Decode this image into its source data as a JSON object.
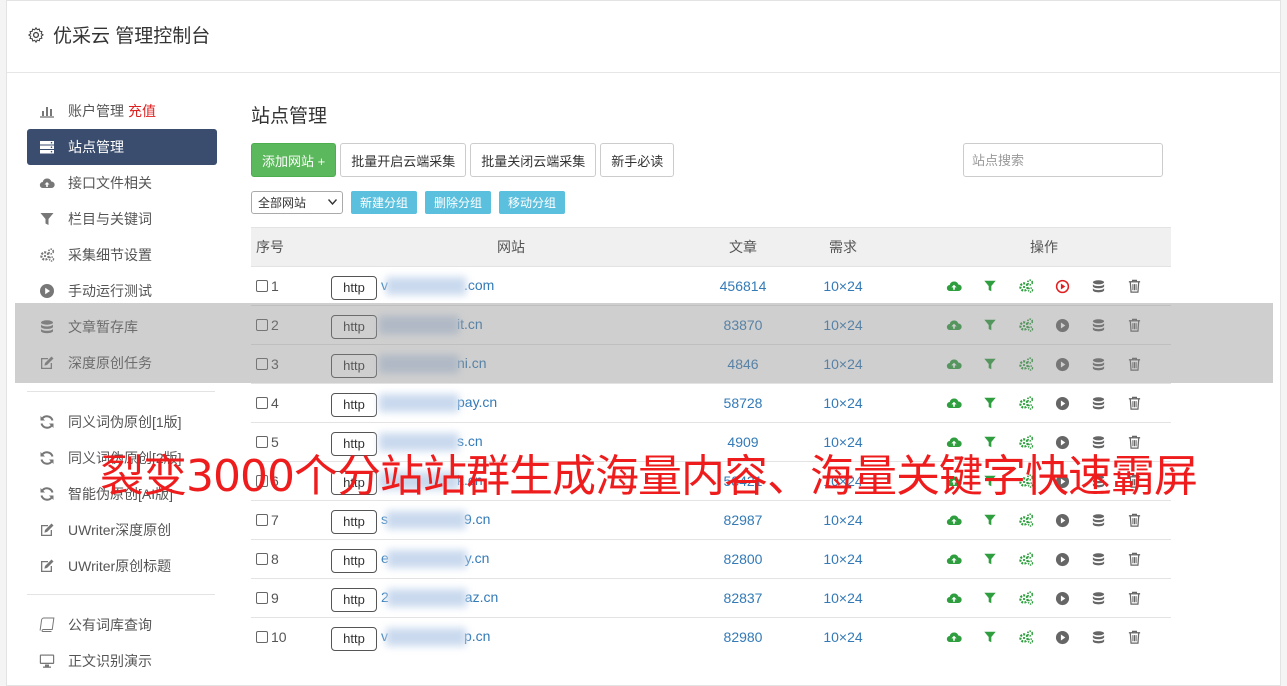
{
  "header": {
    "title": "优采云 管理控制台"
  },
  "sidebar": {
    "group1": [
      {
        "label": "账户管理",
        "extra": "充值",
        "icon": "bar-chart-icon"
      },
      {
        "label": "站点管理",
        "icon": "server-icon",
        "active": true
      },
      {
        "label": "接口文件相关",
        "icon": "cloud-upload-icon"
      },
      {
        "label": "栏目与关键词",
        "icon": "filter-icon"
      },
      {
        "label": "采集细节设置",
        "icon": "gears-icon"
      },
      {
        "label": "手动运行测试",
        "icon": "play-circle-icon"
      },
      {
        "label": "文章暂存库",
        "icon": "database-icon"
      },
      {
        "label": "深度原创任务",
        "icon": "edit-icon"
      }
    ],
    "group2": [
      {
        "label": "同义词伪原创[1版]",
        "icon": "refresh-icon"
      },
      {
        "label": "同义词伪原创[2版]",
        "icon": "refresh-icon"
      },
      {
        "label": "智能伪原创[AI版]",
        "icon": "refresh-icon"
      },
      {
        "label": "UWriter深度原创",
        "icon": "edit-icon"
      },
      {
        "label": "UWriter原创标题",
        "icon": "edit-icon"
      }
    ],
    "group3": [
      {
        "label": "公有词库查询",
        "icon": "book-icon"
      },
      {
        "label": "正文识别演示",
        "icon": "monitor-icon"
      }
    ]
  },
  "main": {
    "title": "站点管理",
    "buttons": {
      "add": "添加网站 +",
      "batch_open": "批量开启云端采集",
      "batch_close": "批量关闭云端采集",
      "newbie": "新手必读"
    },
    "search": {
      "placeholder": "站点搜索",
      "value": ""
    },
    "group_select": "全部网站",
    "group_buttons": {
      "new": "新建分组",
      "delete": "删除分组",
      "move": "移动分组"
    },
    "table": {
      "headers": {
        "no": "序号",
        "site": "网站",
        "articles": "文章",
        "demand": "需求",
        "ops": "操作"
      },
      "rows": [
        {
          "no": "1",
          "proto": "http",
          "pre": "v",
          "post": ".com",
          "articles": "456814",
          "demand": "10×24",
          "play_active": true
        },
        {
          "no": "2",
          "proto": "http",
          "pre": "",
          "post": "it.cn",
          "articles": "83870",
          "demand": "10×24",
          "play_active": false
        },
        {
          "no": "3",
          "proto": "http",
          "pre": "",
          "post": "ni.cn",
          "articles": "4846",
          "demand": "10×24",
          "play_active": false
        },
        {
          "no": "4",
          "proto": "http",
          "pre": "",
          "post": "pay.cn",
          "articles": "58728",
          "demand": "10×24",
          "play_active": false
        },
        {
          "no": "5",
          "proto": "http",
          "pre": "",
          "post": "s.cn",
          "articles": "4909",
          "demand": "10×24",
          "play_active": false
        },
        {
          "no": "6",
          "proto": "http",
          "pre": "",
          "post": "k.cn",
          "articles": "58421",
          "demand": "10×24",
          "play_active": false
        },
        {
          "no": "7",
          "proto": "http",
          "pre": "s",
          "post": "9.cn",
          "articles": "82987",
          "demand": "10×24",
          "play_active": false
        },
        {
          "no": "8",
          "proto": "http",
          "pre": "e",
          "post": "y.cn",
          "articles": "82800",
          "demand": "10×24",
          "play_active": false
        },
        {
          "no": "9",
          "proto": "http",
          "pre": "2",
          "post": "az.cn",
          "articles": "82837",
          "demand": "10×24",
          "play_active": false
        },
        {
          "no": "10",
          "proto": "http",
          "pre": "v",
          "post": "p.cn",
          "articles": "82980",
          "demand": "10×24",
          "play_active": false
        }
      ]
    }
  },
  "overlay": {
    "text": "裂变3000个分站站群生成海量内容、海量关键字快速霸屏"
  },
  "colors": {
    "accent_green": "#5cb85c",
    "info_blue": "#5bc0de",
    "sidebar_active": "#3a4d6e",
    "link": "#337ab7",
    "overlay_red": "#ee1c1c",
    "play_red": "#e02020"
  }
}
